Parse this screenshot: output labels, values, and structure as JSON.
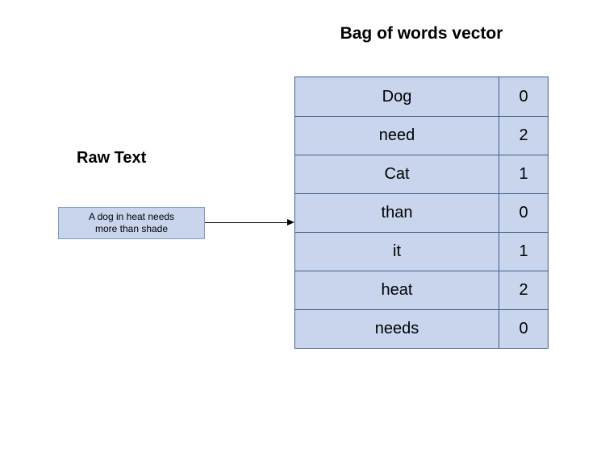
{
  "left": {
    "title": "Raw Text",
    "raw_text_line1": "A dog in heat needs",
    "raw_text_line2": "more than shade"
  },
  "right": {
    "title": "Bag of words vector"
  },
  "rows": [
    {
      "word": "Dog",
      "count": "0"
    },
    {
      "word": "need",
      "count": "2"
    },
    {
      "word": "Cat",
      "count": "1"
    },
    {
      "word": "than",
      "count": "0"
    },
    {
      "word": "it",
      "count": "1"
    },
    {
      "word": "heat",
      "count": "2"
    },
    {
      "word": "needs",
      "count": "0"
    }
  ]
}
